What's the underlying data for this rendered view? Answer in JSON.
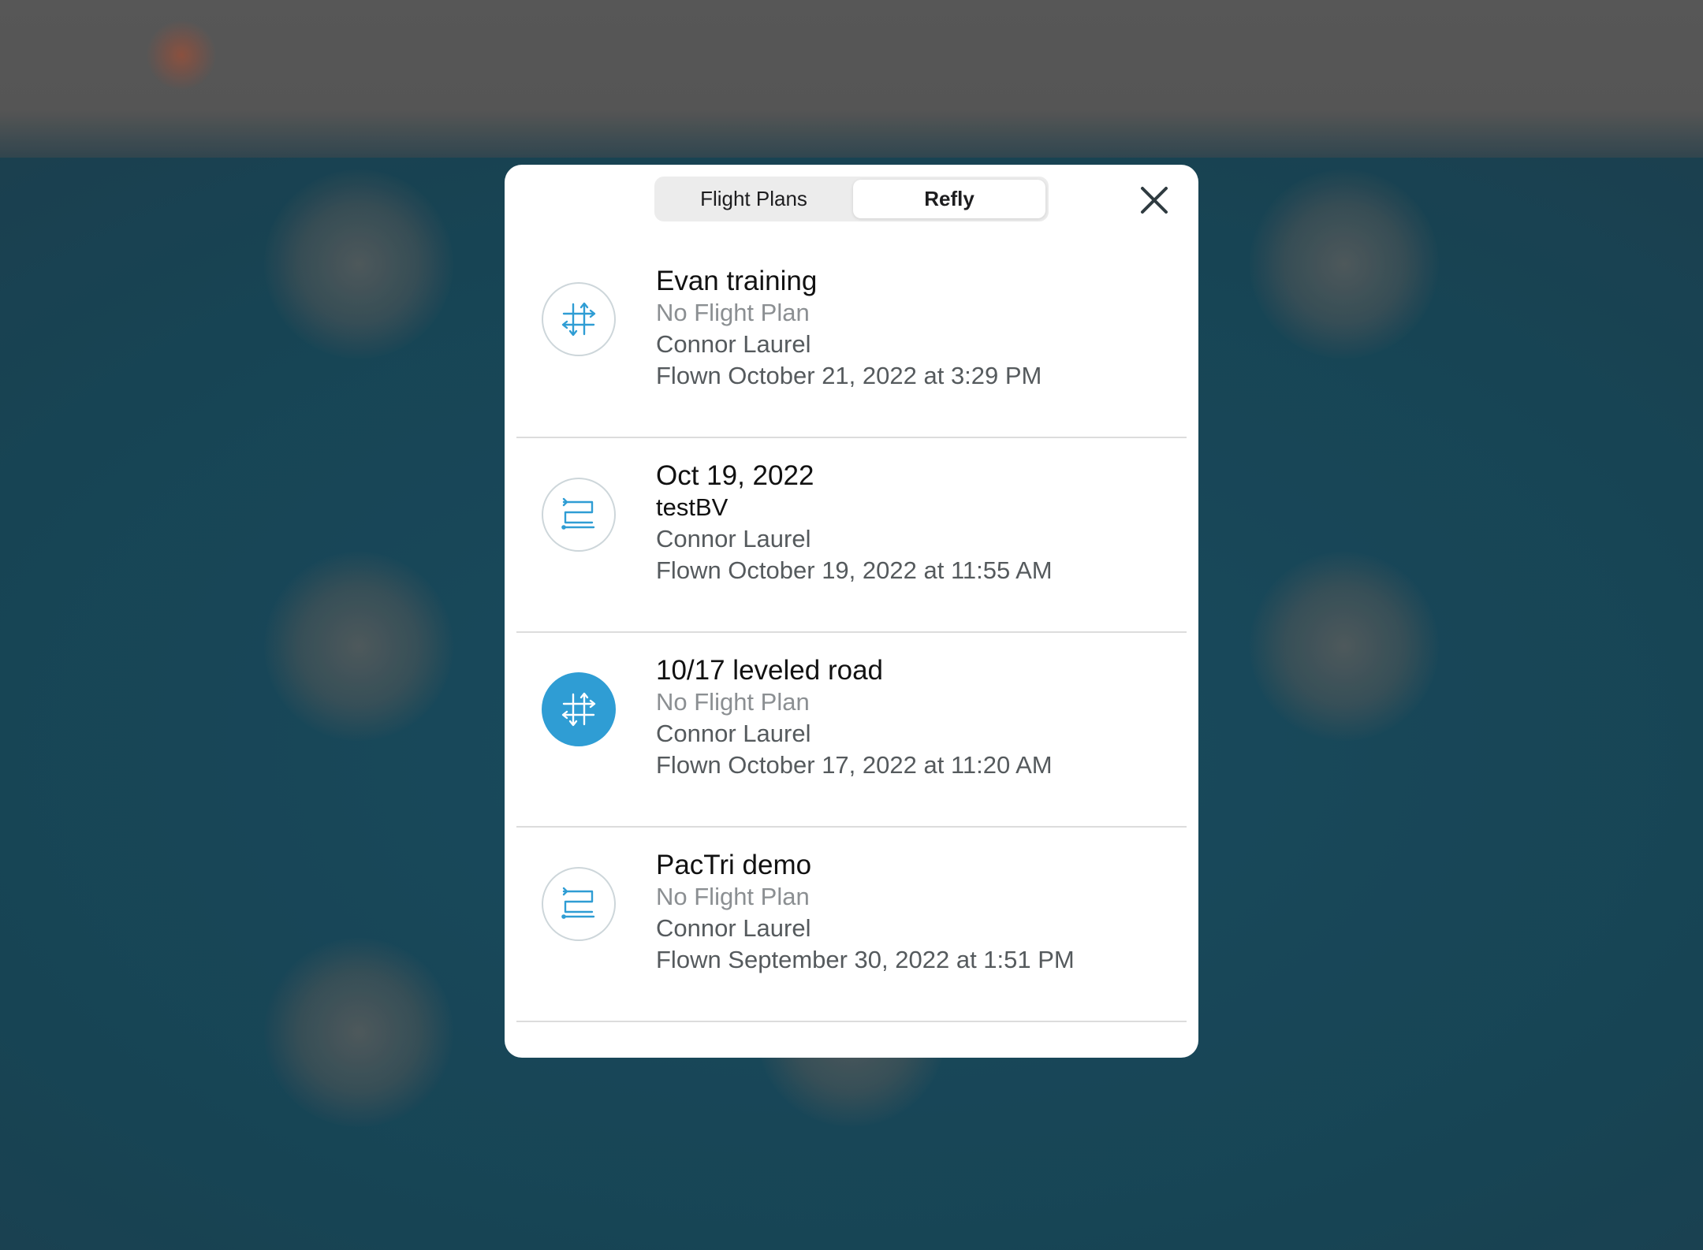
{
  "tabs": {
    "flight_plans": "Flight Plans",
    "refly": "Refly",
    "selected": "Refly"
  },
  "colors": {
    "accent": "#2f9dd4",
    "close_icon": "#2f3b40"
  },
  "items": [
    {
      "title": "Evan training",
      "plan": "No Flight Plan",
      "pilot": "Connor Laurel",
      "flown": "Flown October 21, 2022 at 3:29 PM",
      "icon": "grid-pattern-icon",
      "selected": false
    },
    {
      "title": "Oct 19, 2022",
      "plan": "testBV",
      "pilot": "Connor Laurel",
      "flown": "Flown October 19, 2022 at 11:55 AM",
      "icon": "lawnmower-path-icon",
      "selected": false
    },
    {
      "title": "10/17 leveled road",
      "plan": "No Flight Plan",
      "pilot": "Connor Laurel",
      "flown": "Flown October 17, 2022 at 11:20 AM",
      "icon": "grid-pattern-icon",
      "selected": true
    },
    {
      "title": "PacTri demo",
      "plan": "No Flight Plan",
      "pilot": "Connor Laurel",
      "flown": "Flown September 30, 2022 at 1:51 PM",
      "icon": "lawnmower-path-icon",
      "selected": false
    }
  ]
}
